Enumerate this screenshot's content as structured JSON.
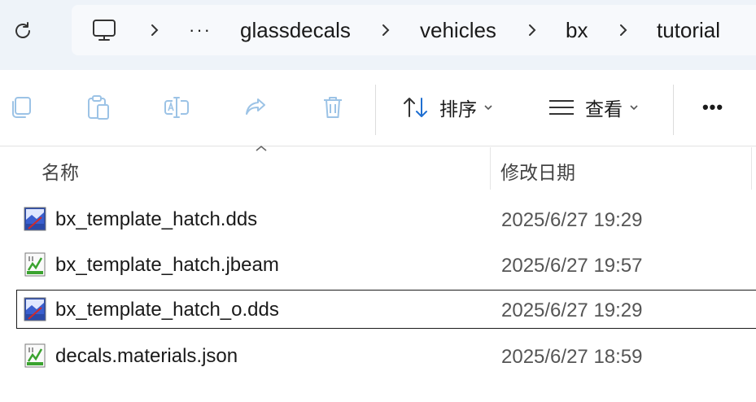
{
  "address_bar": {
    "breadcrumbs": [
      "glassdecals",
      "vehicles",
      "bx",
      "tutorial"
    ],
    "overflow_label": "···",
    "root_icon": "computer-icon",
    "refresh_icon": "refresh-icon"
  },
  "toolbar": {
    "buttons": [
      {
        "name": "copy",
        "icon": "copy-icon"
      },
      {
        "name": "paste",
        "icon": "paste-icon"
      },
      {
        "name": "rename",
        "icon": "rename-icon"
      },
      {
        "name": "share",
        "icon": "share-icon"
      },
      {
        "name": "delete",
        "icon": "trash-icon"
      }
    ],
    "sort_label": "排序",
    "view_label": "查看",
    "more_label": "•••"
  },
  "columns": {
    "name": "名称",
    "date": "修改日期"
  },
  "files": [
    {
      "name": "bx_template_hatch.dds",
      "date": "2025/6/27 19:29",
      "type": "dds"
    },
    {
      "name": "bx_template_hatch.jbeam",
      "date": "2025/6/27 19:57",
      "type": "text"
    },
    {
      "name": "bx_template_hatch_o.dds",
      "date": "2025/6/27 19:29",
      "type": "dds",
      "selected": true
    },
    {
      "name": "decals.materials.json",
      "date": "2025/6/27 18:59",
      "type": "text"
    }
  ],
  "colors": {
    "address_bg": "#eef3f9",
    "accent": "#1f6fd1",
    "disabled_icon": "#9cc3e6"
  }
}
